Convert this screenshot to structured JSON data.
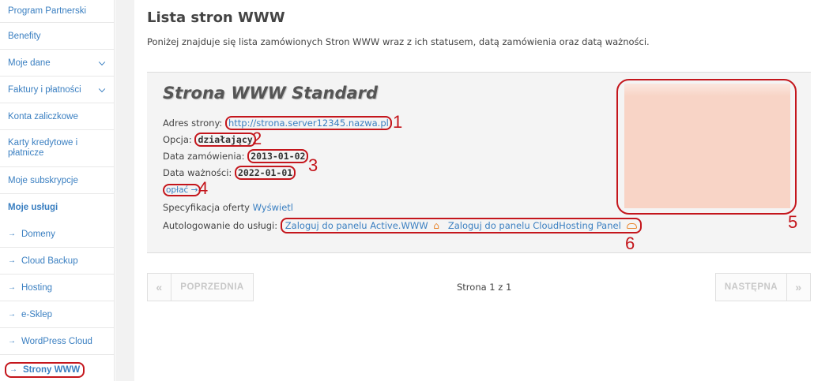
{
  "sidebar": {
    "items": [
      {
        "label": "Program Partnerski"
      },
      {
        "label": "Benefity"
      },
      {
        "label": "Moje dane"
      },
      {
        "label": "Faktury i płatności"
      },
      {
        "label": "Konta zaliczkowe"
      },
      {
        "label": "Karty kredytowe i płatnicze"
      },
      {
        "label": "Moje subskrypcje"
      }
    ],
    "section_heading": "Moje usługi",
    "services": [
      {
        "label": "Domeny"
      },
      {
        "label": "Cloud Backup"
      },
      {
        "label": "Hosting"
      },
      {
        "label": "e-Sklep"
      },
      {
        "label": "WordPress Cloud"
      },
      {
        "label": "Strony WWW"
      }
    ]
  },
  "main": {
    "title": "Lista stron WWW",
    "intro": "Poniżej znajduje się lista zamówionych Stron WWW wraz z ich statusem, datą zamówienia oraz datą ważności.",
    "product": {
      "name": "Strona WWW Standard",
      "address_label": "Adres strony:",
      "address_value": "http://strona.server12345.nazwa.pl",
      "option_label": "Opcja:",
      "option_value": "działający",
      "order_date_label": "Data zamówienia:",
      "order_date_value": "2013-01-02",
      "expiry_label": "Data ważności:",
      "expiry_value": "2022-01-01",
      "pay_link": "opłać",
      "spec_label": "Specyfikacja oferty",
      "spec_link": "Wyświetl",
      "autologin_label": "Autologowanie do usługi:",
      "login_active": "Zaloguj do panelu Active.WWW",
      "login_cloud": "Zaloguj do panelu CloudHosting Panel"
    },
    "markers": [
      "1",
      "2",
      "3",
      "4",
      "5",
      "6"
    ]
  },
  "pagination": {
    "first_symbol": "«",
    "prev_label": "POPRZEDNIA",
    "page_info": "Strona 1 z 1",
    "next_label": "NASTĘPNA",
    "last_symbol": "»"
  },
  "colors": {
    "link": "#3a7fc1",
    "annotation": "#c4161c",
    "icon_accent": "#e8832a"
  }
}
